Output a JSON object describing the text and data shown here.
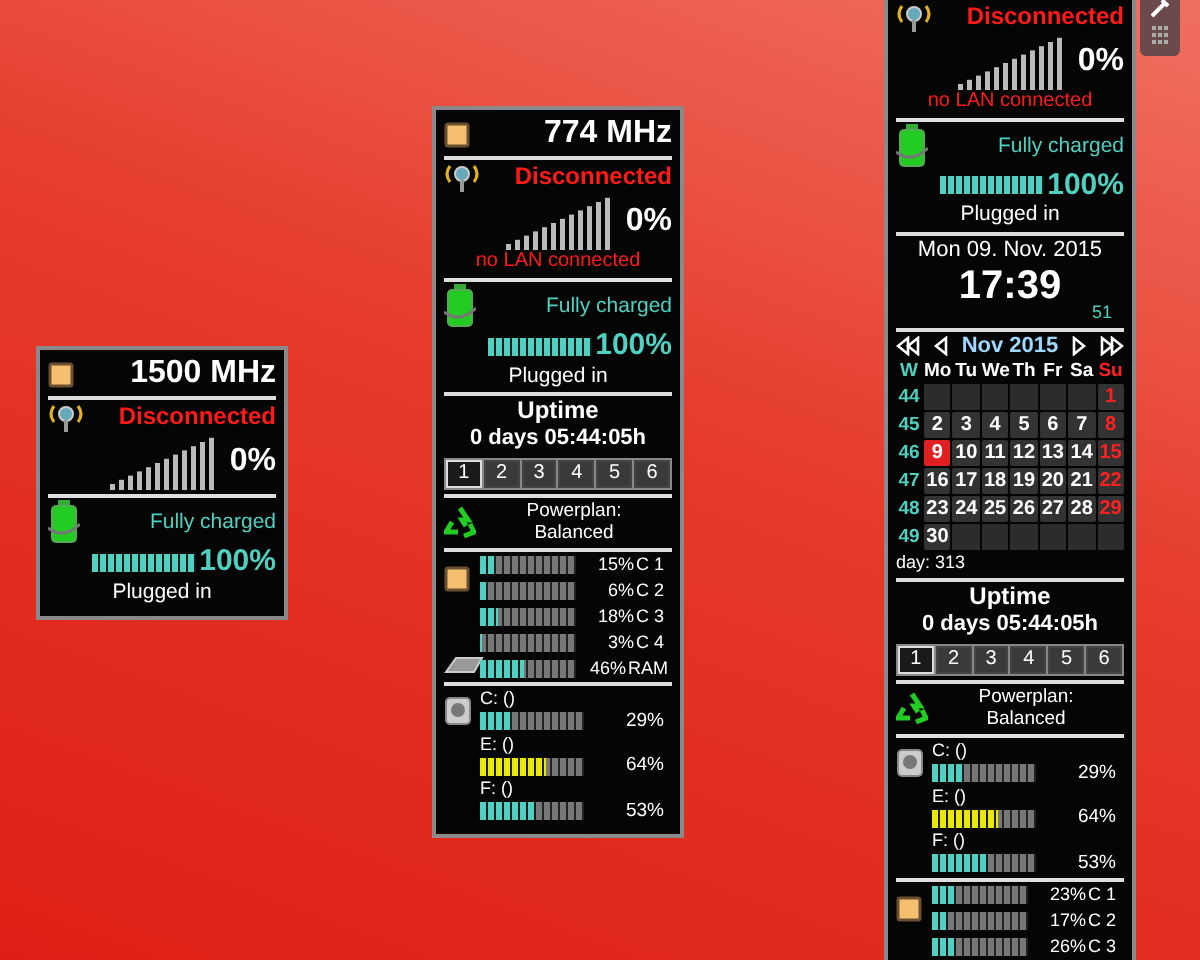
{
  "gadgets": [
    {
      "sections": [
        {
          "kind": "cpu",
          "frequency": "1500 MHz"
        },
        {
          "kind": "network",
          "status": "Disconnected",
          "reading": "0%"
        },
        {
          "kind": "battery",
          "status": "Fully charged",
          "level": 1,
          "reading": "100%",
          "power": "Plugged in"
        }
      ]
    },
    {
      "sections": [
        {
          "kind": "cpu",
          "frequency": "774 MHz"
        },
        {
          "kind": "network",
          "status": "Disconnected",
          "reading": "0%",
          "lan": "no LAN connected"
        },
        {
          "kind": "battery",
          "status": "Fully charged",
          "level": 1,
          "reading": "100%",
          "power": "Plugged in"
        },
        {
          "kind": "uptime",
          "title": "Uptime",
          "value": "0 days 05:44:05h"
        },
        {
          "kind": "tabs",
          "tabs": [
            {
              "label": "1",
              "selected": true
            },
            {
              "label": "2",
              "selected": false
            },
            {
              "label": "3",
              "selected": false
            },
            {
              "label": "4",
              "selected": false
            },
            {
              "label": "5",
              "selected": false
            },
            {
              "label": "6",
              "selected": false
            }
          ]
        },
        {
          "kind": "power",
          "label": "Powerplan:",
          "plan": "Balanced"
        },
        {
          "kind": "cores",
          "rows": [
            {
              "kind": "core",
              "level": 0.15,
              "reading": "15%",
              "label": "C 1"
            },
            {
              "kind": "core",
              "level": 0.06,
              "reading": "6%",
              "label": "C 2"
            },
            {
              "kind": "core",
              "level": 0.18,
              "reading": "18%",
              "label": "C 3"
            },
            {
              "kind": "core",
              "level": 0.03,
              "reading": "3%",
              "label": "C 4"
            },
            {
              "kind": "ram",
              "level": 0.46,
              "reading": "46%",
              "label": "RAM"
            }
          ]
        },
        {
          "kind": "drives",
          "rows": [
            {
              "label": "C: ()",
              "level": 0.29,
              "reading": "29%",
              "color": "#4fd0c0"
            },
            {
              "label": "E: ()",
              "level": 0.64,
              "reading": "64%",
              "color": "#e8e800"
            },
            {
              "label": "F: ()",
              "level": 0.53,
              "reading": "53%",
              "color": "#4fd0c0"
            }
          ]
        }
      ]
    },
    {
      "sections": [
        {
          "kind": "network",
          "status": "Disconnected",
          "reading": "0%",
          "lan": "no LAN connected"
        },
        {
          "kind": "battery",
          "status": "Fully charged",
          "level": 1,
          "reading": "100%",
          "power": "Plugged in"
        },
        {
          "kind": "date",
          "date": "Mon 09. Nov. 2015",
          "time": "17:39",
          "seconds": "51"
        },
        {
          "kind": "calendar",
          "title": "Nov 2015",
          "week_label": "W",
          "weekdays": [
            "Mo",
            "Tu",
            "We",
            "Th",
            "Fr",
            "Sa",
            "Su"
          ],
          "footer": "day: 313",
          "weeks": [
            {
              "number": "44",
              "days": [
                {
                  "kind": "blank"
                },
                {
                  "kind": "blank"
                },
                {
                  "kind": "blank"
                },
                {
                  "kind": "blank"
                },
                {
                  "kind": "blank"
                },
                {
                  "kind": "blank"
                },
                {
                  "kind": "day",
                  "text": "1",
                  "selected": false
                }
              ]
            },
            {
              "number": "45",
              "days": [
                {
                  "kind": "day",
                  "text": "2",
                  "selected": false
                },
                {
                  "kind": "day",
                  "text": "3",
                  "selected": false
                },
                {
                  "kind": "day",
                  "text": "4",
                  "selected": false
                },
                {
                  "kind": "day",
                  "text": "5",
                  "selected": false
                },
                {
                  "kind": "day",
                  "text": "6",
                  "selected": false
                },
                {
                  "kind": "day",
                  "text": "7",
                  "selected": false
                },
                {
                  "kind": "day",
                  "text": "8",
                  "selected": false
                }
              ]
            },
            {
              "number": "46",
              "days": [
                {
                  "kind": "day",
                  "text": "9",
                  "selected": true
                },
                {
                  "kind": "day",
                  "text": "10",
                  "selected": false
                },
                {
                  "kind": "day",
                  "text": "11",
                  "selected": false
                },
                {
                  "kind": "day",
                  "text": "12",
                  "selected": false
                },
                {
                  "kind": "day",
                  "text": "13",
                  "selected": false
                },
                {
                  "kind": "day",
                  "text": "14",
                  "selected": false
                },
                {
                  "kind": "day",
                  "text": "15",
                  "selected": false
                }
              ]
            },
            {
              "number": "47",
              "days": [
                {
                  "kind": "day",
                  "text": "16",
                  "selected": false
                },
                {
                  "kind": "day",
                  "text": "17",
                  "selected": false
                },
                {
                  "kind": "day",
                  "text": "18",
                  "selected": false
                },
                {
                  "kind": "day",
                  "text": "19",
                  "selected": false
                },
                {
                  "kind": "day",
                  "text": "20",
                  "selected": false
                },
                {
                  "kind": "day",
                  "text": "21",
                  "selected": false
                },
                {
                  "kind": "day",
                  "text": "22",
                  "selected": false
                }
              ]
            },
            {
              "number": "48",
              "days": [
                {
                  "kind": "day",
                  "text": "23",
                  "selected": false
                },
                {
                  "kind": "day",
                  "text": "24",
                  "selected": false
                },
                {
                  "kind": "day",
                  "text": "25",
                  "selected": false
                },
                {
                  "kind": "day",
                  "text": "26",
                  "selected": false
                },
                {
                  "kind": "day",
                  "text": "27",
                  "selected": false
                },
                {
                  "kind": "day",
                  "text": "28",
                  "selected": false
                },
                {
                  "kind": "day",
                  "text": "29",
                  "selected": false
                }
              ]
            },
            {
              "number": "49",
              "days": [
                {
                  "kind": "day",
                  "text": "30",
                  "selected": false
                },
                {
                  "kind": "blank"
                },
                {
                  "kind": "blank"
                },
                {
                  "kind": "blank"
                },
                {
                  "kind": "blank"
                },
                {
                  "kind": "blank"
                },
                {
                  "kind": "blank"
                }
              ]
            }
          ]
        },
        {
          "kind": "uptime",
          "title": "Uptime",
          "value": "0 days 05:44:05h"
        },
        {
          "kind": "tabs",
          "tabs": [
            {
              "label": "1",
              "selected": true
            },
            {
              "label": "2",
              "selected": false
            },
            {
              "label": "3",
              "selected": false
            },
            {
              "label": "4",
              "selected": false
            },
            {
              "label": "5",
              "selected": false
            },
            {
              "label": "6",
              "selected": false
            }
          ]
        },
        {
          "kind": "power",
          "label": "Powerplan:",
          "plan": "Balanced"
        },
        {
          "kind": "drives",
          "rows": [
            {
              "label": "C: ()",
              "level": 0.29,
              "reading": "29%",
              "color": "#4fd0c0"
            },
            {
              "label": "E: ()",
              "level": 0.64,
              "reading": "64%",
              "color": "#e8e800"
            },
            {
              "label": "F: ()",
              "level": 0.53,
              "reading": "53%",
              "color": "#4fd0c0"
            }
          ]
        },
        {
          "kind": "cores",
          "rows": [
            {
              "kind": "core",
              "level": 0.23,
              "reading": "23%",
              "label": "C 1"
            },
            {
              "kind": "core",
              "level": 0.17,
              "reading": "17%",
              "label": "C 2"
            },
            {
              "kind": "core",
              "level": 0.26,
              "reading": "26%",
              "label": "C 3"
            }
          ]
        }
      ]
    }
  ]
}
